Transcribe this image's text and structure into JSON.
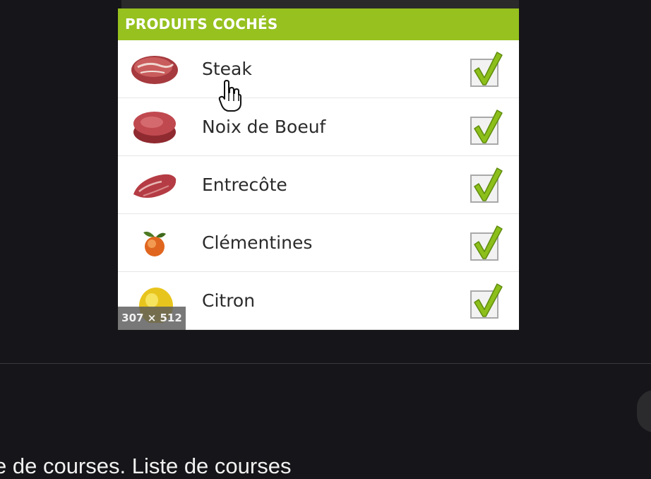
{
  "panel": {
    "header": "PRODUITS COCHÉS",
    "items": [
      {
        "label": "Steak",
        "icon": "steak-icon",
        "checked": true
      },
      {
        "label": "Noix de Boeuf",
        "icon": "beef-icon",
        "checked": true
      },
      {
        "label": "Entrecôte",
        "icon": "entrecote-icon",
        "checked": true
      },
      {
        "label": "Clémentines",
        "icon": "clementine-icon",
        "checked": true
      },
      {
        "label": "Citron",
        "icon": "lemon-icon",
        "checked": true
      }
    ]
  },
  "image_badge": "307 × 512",
  "caption_text": "e de courses. Liste de courses",
  "colors": {
    "header_green": "#96c11f",
    "check_green": "#8cbf1a",
    "background": "#161519"
  }
}
